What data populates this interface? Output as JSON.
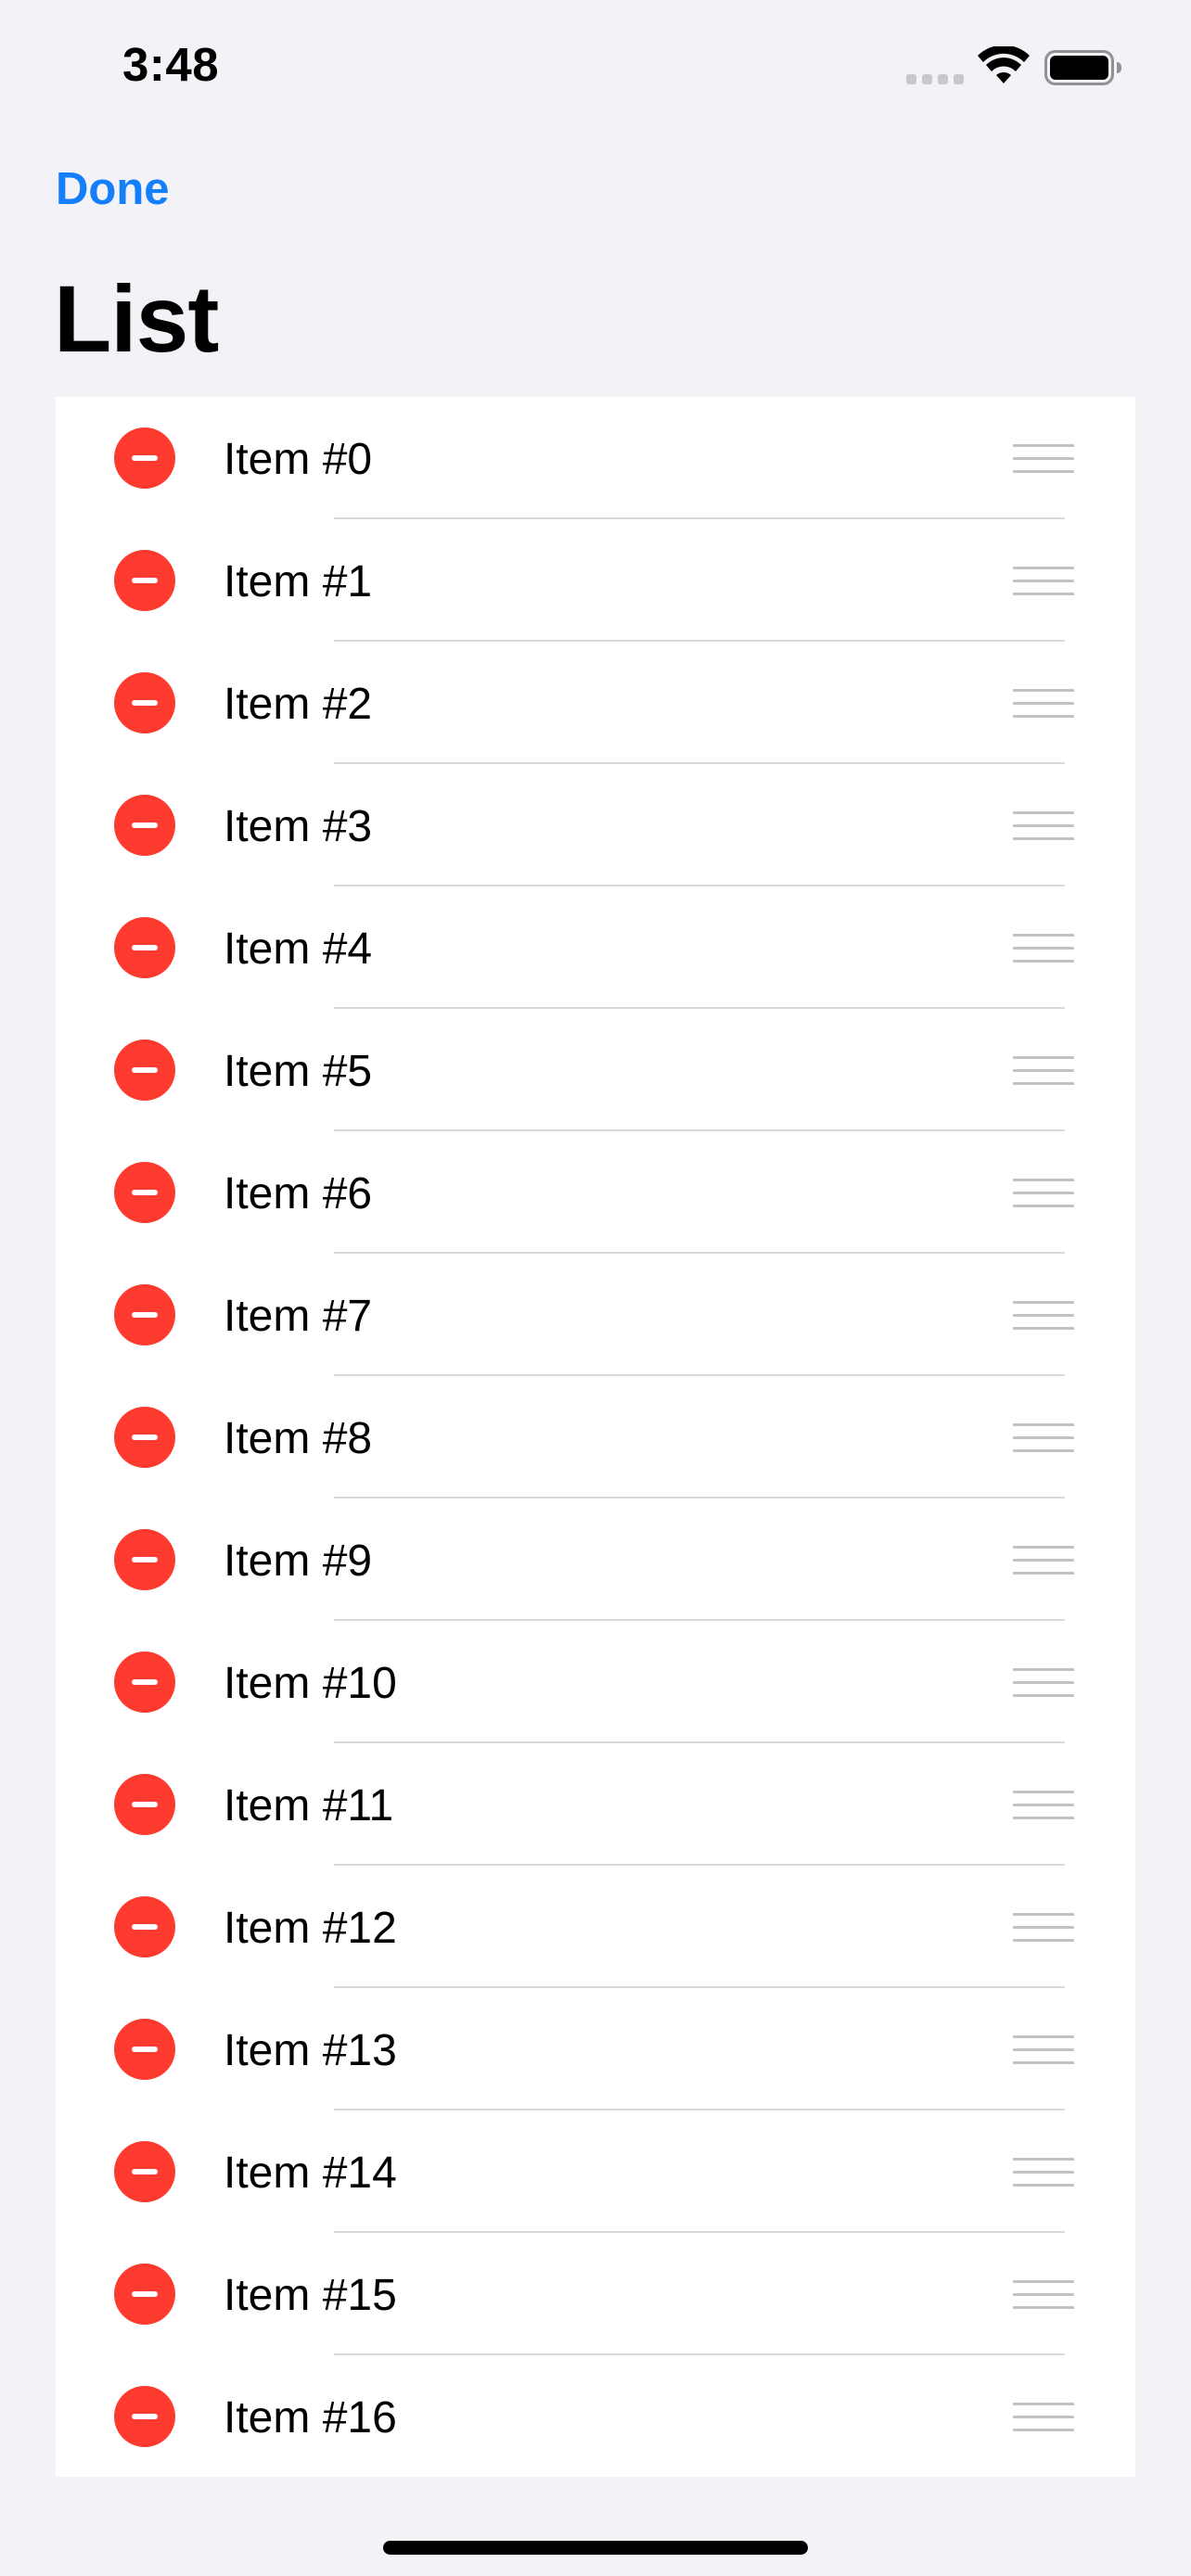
{
  "status_bar": {
    "time": "3:48"
  },
  "nav": {
    "done_label": "Done",
    "title": "List"
  },
  "list": {
    "items": [
      {
        "label": "Item #0"
      },
      {
        "label": "Item #1"
      },
      {
        "label": "Item #2"
      },
      {
        "label": "Item #3"
      },
      {
        "label": "Item #4"
      },
      {
        "label": "Item #5"
      },
      {
        "label": "Item #6"
      },
      {
        "label": "Item #7"
      },
      {
        "label": "Item #8"
      },
      {
        "label": "Item #9"
      },
      {
        "label": "Item #10"
      },
      {
        "label": "Item #11"
      },
      {
        "label": "Item #12"
      },
      {
        "label": "Item #13"
      },
      {
        "label": "Item #14"
      },
      {
        "label": "Item #15"
      },
      {
        "label": "Item #16"
      }
    ]
  },
  "colors": {
    "accent": "#147efb",
    "delete": "#ff3b30",
    "background": "#f2f2f7"
  },
  "icons": {
    "delete": "minus-circle-icon",
    "reorder": "reorder-handle-icon",
    "wifi": "wifi-icon",
    "battery": "battery-icon",
    "signal": "cellular-signal-icon"
  }
}
